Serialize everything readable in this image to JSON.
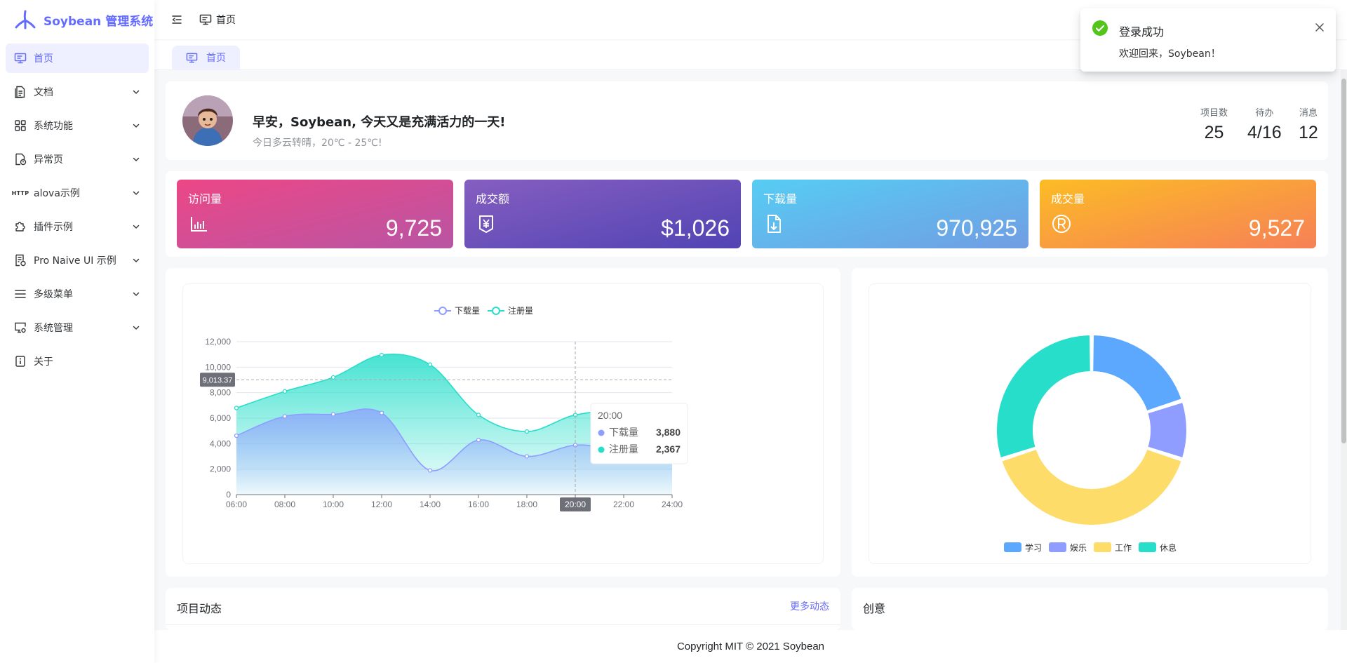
{
  "app": {
    "title": "Soybean 管理系统"
  },
  "sidebar": {
    "items": [
      {
        "label": "首页",
        "icon": "monitor-icon",
        "active": true,
        "expandable": false
      },
      {
        "label": "文档",
        "icon": "document-icon",
        "expandable": true
      },
      {
        "label": "系统功能",
        "icon": "grid-icon",
        "expandable": true
      },
      {
        "label": "异常页",
        "icon": "file-warning-icon",
        "expandable": true
      },
      {
        "label": "alova示例",
        "icon": "http-icon",
        "icon_text": "HTTP",
        "expandable": true
      },
      {
        "label": "插件示例",
        "icon": "puzzle-icon",
        "expandable": true
      },
      {
        "label": "Pro Naive UI 示例",
        "icon": "form-icon",
        "expandable": true
      },
      {
        "label": "多级菜单",
        "icon": "menu-lines-icon",
        "expandable": true
      },
      {
        "label": "系统管理",
        "icon": "monitor-settings-icon",
        "expandable": true
      },
      {
        "label": "关于",
        "icon": "info-icon",
        "expandable": false
      }
    ]
  },
  "header": {
    "breadcrumb": "首页"
  },
  "tabs": [
    {
      "label": "首页",
      "active": true
    }
  ],
  "greeting": {
    "title": "早安，Soybean, 今天又是充满活力的一天!",
    "weather": "今日多云转晴，20℃ - 25℃!",
    "stats": [
      {
        "label": "项目数",
        "value": "25"
      },
      {
        "label": "待办",
        "value": "4/16"
      },
      {
        "label": "消息",
        "value": "12"
      }
    ]
  },
  "metrics": [
    {
      "title": "访问量",
      "value": "9,725",
      "icon": "bar-chart-icon",
      "colors": [
        "#ec4786",
        "#b955a4"
      ]
    },
    {
      "title": "成交额",
      "value": "$1,026",
      "icon": "money-bag-icon",
      "colors": [
        "#865ec0",
        "#5144b4"
      ]
    },
    {
      "title": "下载量",
      "value": "970,925",
      "icon": "download-file-icon",
      "colors": [
        "#56cdf3",
        "#719de3"
      ]
    },
    {
      "title": "成交量",
      "value": "9,527",
      "icon": "registered-icon",
      "colors": [
        "#fcbc25",
        "#f68057"
      ]
    }
  ],
  "chart_data": [
    {
      "type": "area",
      "x": [
        "06:00",
        "08:00",
        "10:00",
        "12:00",
        "14:00",
        "16:00",
        "18:00",
        "20:00",
        "22:00",
        "24:00"
      ],
      "series": [
        {
          "name": "下载量",
          "color": "#8e9dff",
          "values": [
            4623,
            6145,
            6302,
            6411,
            1900,
            4280,
            3000,
            3880,
            3620,
            4300
          ]
        },
        {
          "name": "注册量",
          "color": "#26deca",
          "values": [
            6800,
            8100,
            9200,
            10950,
            10200,
            6250,
            4950,
            6250,
            6450,
            5000
          ]
        }
      ],
      "ylim": [
        0,
        12000
      ],
      "yticks": [
        "0",
        "2,000",
        "4,000",
        "6,000",
        "8,000",
        "10,000",
        "12,000"
      ],
      "axis_pointer": {
        "x_label": "20:00",
        "y_label": "9,013.37"
      },
      "tooltip": {
        "title": "20:00",
        "rows": [
          {
            "name": "下载量",
            "value": "3,880"
          },
          {
            "name": "注册量",
            "value": "2,367"
          }
        ]
      }
    },
    {
      "type": "pie",
      "donut": true,
      "slices": [
        {
          "name": "学习",
          "value": 20,
          "color": "#5da8ff"
        },
        {
          "name": "娱乐",
          "value": 10,
          "color": "#8e9dff"
        },
        {
          "name": "工作",
          "value": 40,
          "color": "#fedc69"
        },
        {
          "name": "休息",
          "value": 30,
          "color": "#26deca"
        }
      ]
    }
  ],
  "news": {
    "title": "项目动态",
    "more": "更多动态"
  },
  "idea": {
    "title": "创意"
  },
  "footer": {
    "text": "Copyright MIT © 2021 Soybean"
  },
  "notification": {
    "title": "登录成功",
    "body": "欢迎回来，Soybean！"
  }
}
